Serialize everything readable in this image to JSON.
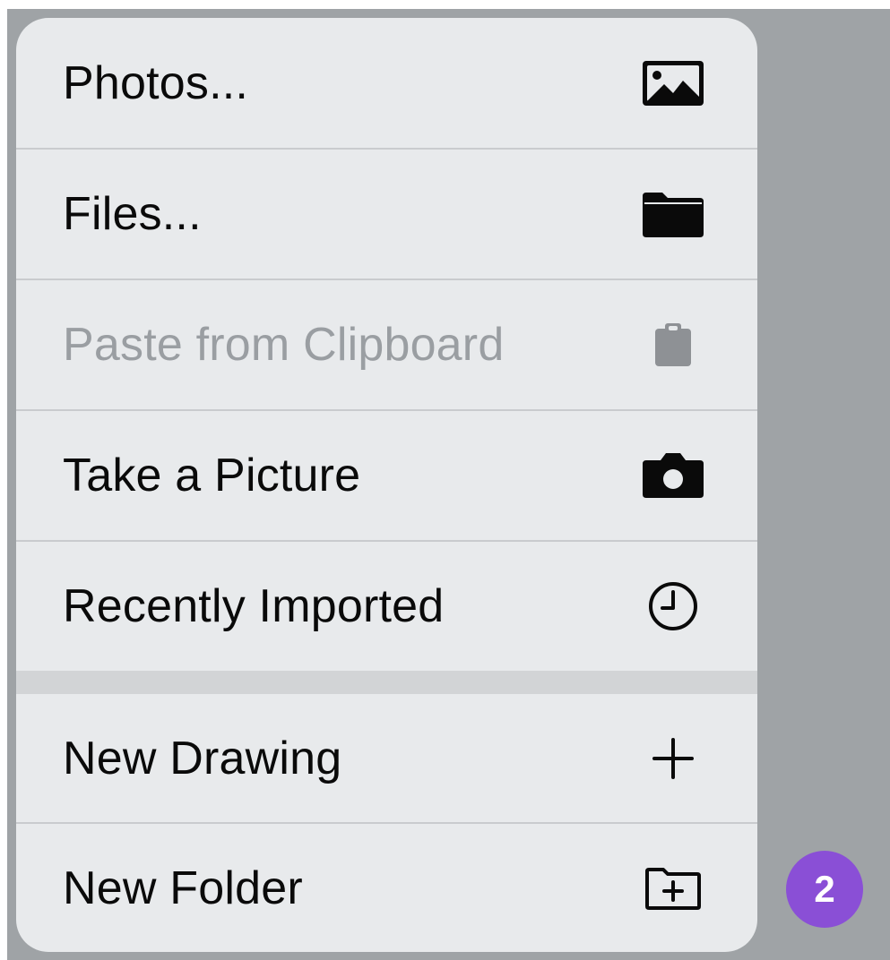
{
  "menu": {
    "items": [
      {
        "label": "Photos...",
        "icon": "photo-icon",
        "enabled": true
      },
      {
        "label": "Files...",
        "icon": "folder-icon",
        "enabled": true
      },
      {
        "label": "Paste from Clipboard",
        "icon": "clipboard-icon",
        "enabled": false
      },
      {
        "label": "Take a Picture",
        "icon": "camera-icon",
        "enabled": true
      },
      {
        "label": "Recently Imported",
        "icon": "clock-icon",
        "enabled": true
      },
      {
        "label": "New Drawing",
        "icon": "plus-icon",
        "enabled": true
      },
      {
        "label": "New Folder",
        "icon": "new-folder-icon",
        "enabled": true
      }
    ]
  },
  "badge": {
    "label": "2"
  },
  "colors": {
    "menu_background": "#e8eaec",
    "backdrop": "#9fa3a6",
    "disabled_text": "#9a9ea2",
    "badge_background": "#8a4fd6"
  }
}
